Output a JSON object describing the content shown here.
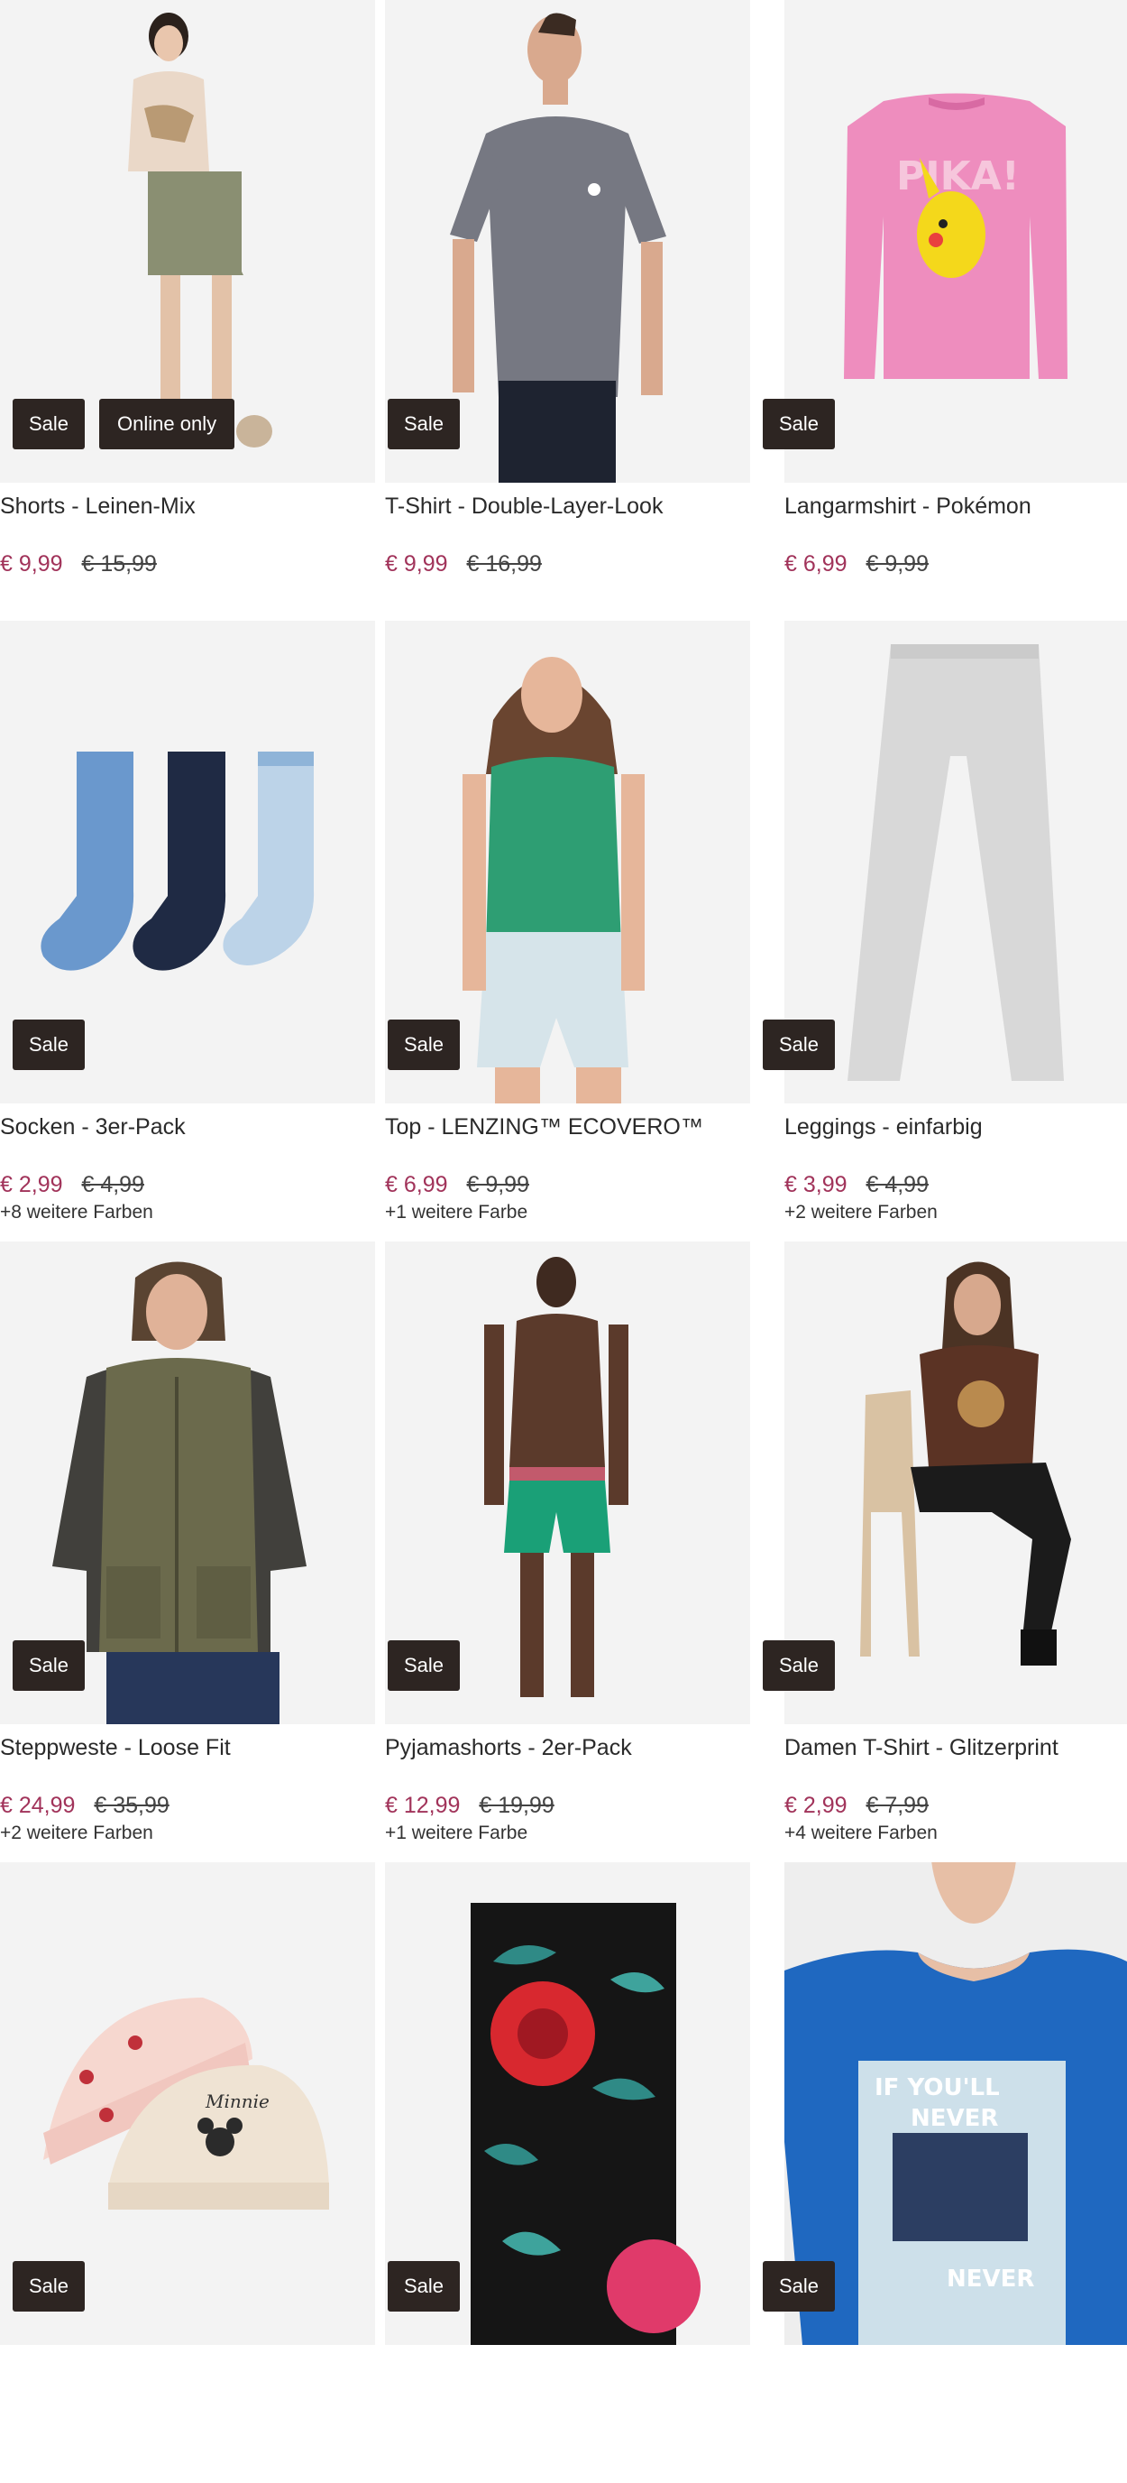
{
  "products": [
    {
      "title": "Shorts - Leinen-Mix",
      "price": "€ 9,99",
      "old_price": "€ 15,99",
      "colors": "",
      "badges": [
        "Sale",
        "Online only"
      ],
      "image": "woman-in-linen-shorts"
    },
    {
      "title": "T-Shirt - Double-Layer-Look",
      "price": "€ 9,99",
      "old_price": "€ 16,99",
      "colors": "",
      "badges": [
        "Sale"
      ],
      "image": "man-in-grey-tshirt"
    },
    {
      "title": "Langarmshirt - Pokémon",
      "price": "€ 6,99",
      "old_price": "€ 9,99",
      "colors": "",
      "badges": [
        "Sale"
      ],
      "image": "pink-pikachu-longsleeve"
    },
    {
      "title": "Socken - 3er-Pack",
      "price": "€ 2,99",
      "old_price": "€ 4,99",
      "colors": "+8 weitere Farben",
      "badges": [
        "Sale"
      ],
      "image": "three-socks"
    },
    {
      "title": "Top - LENZING™ ECOVERO™",
      "price": "€ 6,99",
      "old_price": "€ 9,99",
      "colors": "+1 weitere Farbe",
      "badges": [
        "Sale"
      ],
      "image": "woman-green-top"
    },
    {
      "title": "Leggings - einfarbig",
      "price": "€ 3,99",
      "old_price": "€ 4,99",
      "colors": "+2 weitere Farben",
      "badges": [
        "Sale"
      ],
      "image": "grey-leggings"
    },
    {
      "title": "Steppweste - Loose Fit",
      "price": "€ 24,99",
      "old_price": "€ 35,99",
      "colors": "+2 weitere Farben",
      "badges": [
        "Sale"
      ],
      "image": "man-olive-vest"
    },
    {
      "title": "Pyjamashorts - 2er-Pack",
      "price": "€ 12,99",
      "old_price": "€ 19,99",
      "colors": "+1 weitere Farbe",
      "badges": [
        "Sale"
      ],
      "image": "man-green-shorts"
    },
    {
      "title": "Damen T-Shirt - Glitzerprint",
      "price": "€ 2,99",
      "old_price": "€ 7,99",
      "colors": "+4 weitere Farben",
      "badges": [
        "Sale"
      ],
      "image": "woman-brown-tshirt-chair"
    },
    {
      "title": "",
      "price": "",
      "old_price": "",
      "colors": "",
      "badges": [
        "Sale"
      ],
      "image": "minnie-beanies"
    },
    {
      "title": "",
      "price": "",
      "old_price": "",
      "colors": "",
      "badges": [
        "Sale"
      ],
      "image": "floral-scarf"
    },
    {
      "title": "",
      "price": "",
      "old_price": "",
      "colors": "",
      "badges": [
        "Sale"
      ],
      "image": "blue-printed-tshirt"
    }
  ],
  "colors": {
    "price": "#a1335a",
    "badge_bg": "#2d2522",
    "image_bg": "#f2f2f2"
  }
}
